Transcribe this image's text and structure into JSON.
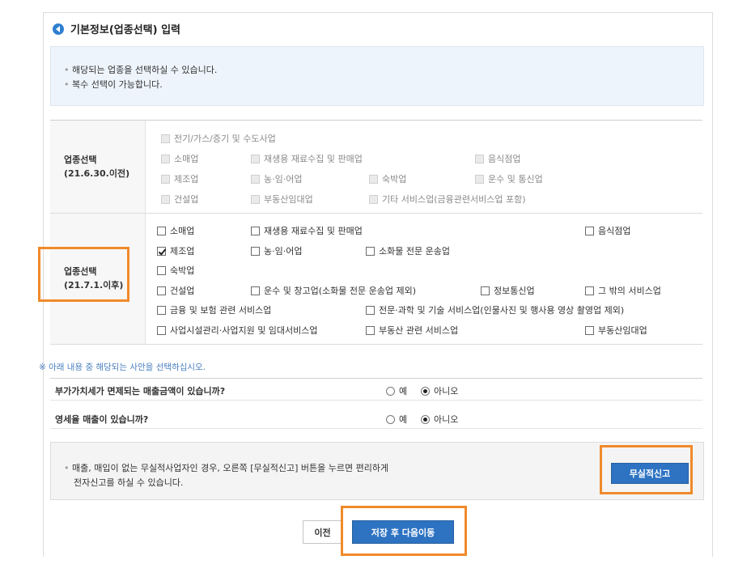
{
  "section": {
    "title": "기본정보(업종선택) 입력"
  },
  "info": {
    "line1": "해당되는 업종을 선택하실 수 있습니다.",
    "line2": "복수 선택이 가능합니다."
  },
  "before": {
    "label": [
      "업종선택",
      "(21.6.30.이전)"
    ],
    "items": [
      {
        "label": "전기/가스/증기 및 수도사업",
        "checked": false,
        "disabled": true
      },
      {
        "label": "소매업",
        "checked": false,
        "disabled": true
      },
      {
        "label": "재생용 재료수집 및 판매업",
        "checked": false,
        "disabled": true
      },
      {
        "label": "음식점업",
        "checked": false,
        "disabled": true
      },
      {
        "label": "제조업",
        "checked": false,
        "disabled": true
      },
      {
        "label": "농·임·어업",
        "checked": false,
        "disabled": true
      },
      {
        "label": "숙박업",
        "checked": false,
        "disabled": true
      },
      {
        "label": "운수 및 통신업",
        "checked": false,
        "disabled": true
      },
      {
        "label": "건설업",
        "checked": false,
        "disabled": true
      },
      {
        "label": "부동산임대업",
        "checked": false,
        "disabled": true
      },
      {
        "label": "기타 서비스업(금융관련서비스업 포함)",
        "checked": false,
        "disabled": true
      }
    ]
  },
  "after": {
    "label": [
      "업종선택",
      "(21.7.1.이후)"
    ],
    "items": [
      {
        "label": "소매업",
        "checked": false
      },
      {
        "label": "재생용 재료수집 및 판매업",
        "checked": false
      },
      {
        "label": "음식점업",
        "checked": false
      },
      {
        "label": "제조업",
        "checked": true
      },
      {
        "label": "농·임·어업",
        "checked": false
      },
      {
        "label": "소화물 전문 운송업",
        "checked": false
      },
      {
        "label": "숙박업",
        "checked": false
      },
      {
        "label": "건설업",
        "checked": false
      },
      {
        "label": "운수 및 창고업(소화물 전문 운송업 제외)",
        "checked": false
      },
      {
        "label": "정보통신업",
        "checked": false
      },
      {
        "label": "그 밖의 서비스업",
        "checked": false
      },
      {
        "label": "금융 및 보험 관련 서비스업",
        "checked": false
      },
      {
        "label": "전문·과학 및 기술 서비스업(인물사진 및 행사용 영상 촬영업 제외)",
        "checked": false
      },
      {
        "label": "사업시설관리·사업지원 및 임대서비스업",
        "checked": false
      },
      {
        "label": "부동산 관련 서비스업",
        "checked": false
      },
      {
        "label": "부동산임대업",
        "checked": false
      }
    ]
  },
  "note": "※ 아래 내용 중 해당되는 사안을 선택하십시오.",
  "questions": [
    {
      "text": "부가가치세가 면제되는 매출금액이 있습니까?",
      "yes": "예",
      "no": "아니오",
      "selected": "no"
    },
    {
      "text": "영세율 매출이 있습니까?",
      "yes": "예",
      "no": "아니오",
      "selected": "no"
    }
  ],
  "zero_report": {
    "line1": "매출, 매입이 없는 무실적사업자인 경우, 오른쪽 [무실적신고] 버튼을 누르면 편리하게",
    "line2": "전자신고를 하실 수 있습니다.",
    "button": "무실적신고"
  },
  "footer": {
    "prev": "이전",
    "save_next": "저장 후 다음이동"
  },
  "colors": {
    "accent": "#2e73c2",
    "highlight": "#f08a2a"
  }
}
